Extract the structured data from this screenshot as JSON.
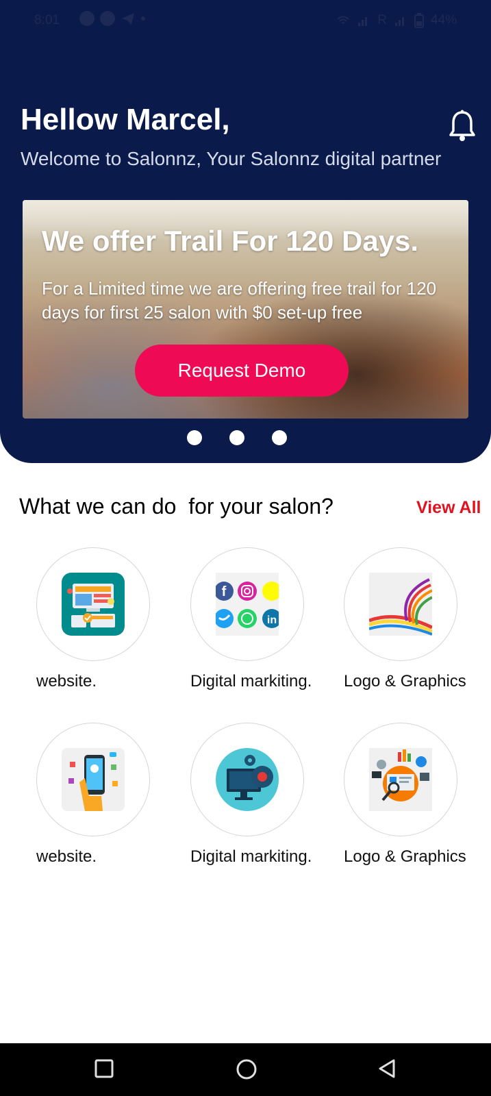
{
  "status_bar": {
    "time": "8:01",
    "roaming": "R",
    "battery": "44%"
  },
  "header": {
    "greeting": "Hellow Marcel,",
    "subtitle": "Welcome to Salonnz, Your Salonnz digital partner"
  },
  "banner": {
    "title": "We offer Trail For 120 Days.",
    "text": "For a Limited time we are offering free trail for 120  days for first 25 salon with $0 set-up free",
    "button_label": "Request Demo",
    "pages": 3
  },
  "services_section": {
    "title": "What we can do  for your salon?",
    "view_all_label": "View All",
    "items": [
      {
        "label": "website.",
        "icon": "website-icon"
      },
      {
        "label": "Digital markiting.",
        "icon": "social-media-icon"
      },
      {
        "label": "Logo & Graphics",
        "icon": "color-swirl-logo-icon"
      },
      {
        "label": "website.",
        "icon": "mobile-app-icon"
      },
      {
        "label": "Digital markiting.",
        "icon": "monitor-gears-icon"
      },
      {
        "label": "Logo & Graphics",
        "icon": "analytics-icon"
      }
    ]
  },
  "colors": {
    "header_bg": "#0a1a4a",
    "accent": "#ee0a55",
    "link_red": "#e0121f"
  }
}
